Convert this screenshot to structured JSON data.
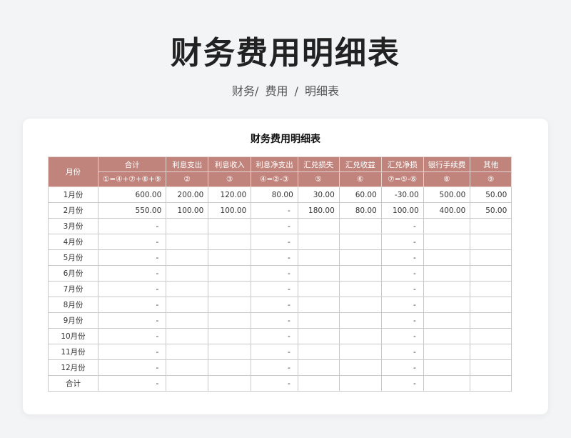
{
  "page": {
    "title": "财务费用明细表",
    "breadcrumb": [
      "财务/",
      "费用",
      "/",
      "明细表"
    ]
  },
  "sheet": {
    "title": "财务费用明细表",
    "month_header": "月份",
    "columns": [
      {
        "label": "合计",
        "formula": "①=④+⑦+⑧+⑨"
      },
      {
        "label": "利息支出",
        "formula": "②"
      },
      {
        "label": "利息收入",
        "formula": "③"
      },
      {
        "label": "利息净支出",
        "formula": "④=②-③"
      },
      {
        "label": "汇兑损失",
        "formula": "⑤"
      },
      {
        "label": "汇兑收益",
        "formula": "⑥"
      },
      {
        "label": "汇兑净损",
        "formula": "⑦=⑤-⑥"
      },
      {
        "label": "银行手续费",
        "formula": "⑧"
      },
      {
        "label": "其他",
        "formula": "⑨"
      }
    ],
    "rows": [
      {
        "month": "1月份",
        "cells": [
          "600.00",
          "200.00",
          "120.00",
          "80.00",
          "30.00",
          "60.00",
          "-30.00",
          "500.00",
          "50.00"
        ]
      },
      {
        "month": "2月份",
        "cells": [
          "550.00",
          "100.00",
          "100.00",
          "-",
          "180.00",
          "80.00",
          "100.00",
          "400.00",
          "50.00"
        ]
      },
      {
        "month": "3月份",
        "cells": [
          "-",
          "",
          "",
          "-",
          "",
          "",
          "-",
          "",
          ""
        ]
      },
      {
        "month": "4月份",
        "cells": [
          "-",
          "",
          "",
          "-",
          "",
          "",
          "-",
          "",
          ""
        ]
      },
      {
        "month": "5月份",
        "cells": [
          "-",
          "",
          "",
          "-",
          "",
          "",
          "-",
          "",
          ""
        ]
      },
      {
        "month": "6月份",
        "cells": [
          "-",
          "",
          "",
          "-",
          "",
          "",
          "-",
          "",
          ""
        ]
      },
      {
        "month": "7月份",
        "cells": [
          "-",
          "",
          "",
          "-",
          "",
          "",
          "-",
          "",
          ""
        ]
      },
      {
        "month": "8月份",
        "cells": [
          "-",
          "",
          "",
          "-",
          "",
          "",
          "-",
          "",
          ""
        ]
      },
      {
        "month": "9月份",
        "cells": [
          "-",
          "",
          "",
          "-",
          "",
          "",
          "-",
          "",
          ""
        ]
      },
      {
        "month": "10月份",
        "cells": [
          "-",
          "",
          "",
          "-",
          "",
          "",
          "-",
          "",
          ""
        ]
      },
      {
        "month": "11月份",
        "cells": [
          "-",
          "",
          "",
          "-",
          "",
          "",
          "-",
          "",
          ""
        ]
      },
      {
        "month": "12月份",
        "cells": [
          "-",
          "",
          "",
          "-",
          "",
          "",
          "-",
          "",
          ""
        ]
      },
      {
        "month": "合计",
        "cells": [
          "-",
          "",
          "",
          "-",
          "",
          "",
          "-",
          "",
          ""
        ]
      }
    ]
  }
}
